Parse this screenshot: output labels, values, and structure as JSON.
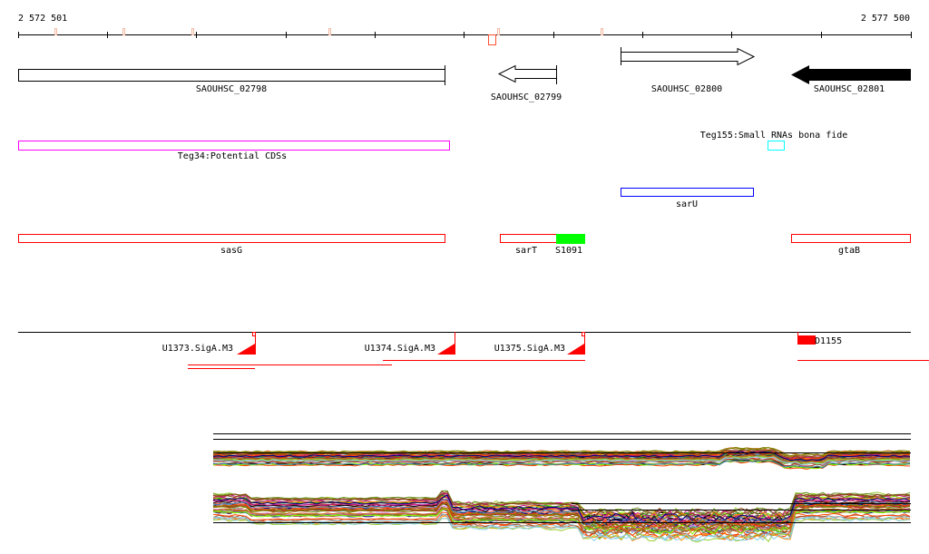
{
  "ruler": {
    "start_label": "2 572 501",
    "end_label": "2 577 500"
  },
  "genes": [
    {
      "name": "SAOUHSC_02798",
      "strand": "none",
      "fill": "#ffffff"
    },
    {
      "name": "SAOUHSC_02799",
      "strand": "-",
      "fill": "#ffffff"
    },
    {
      "name": "SAOUHSC_02800",
      "strand": "+",
      "fill": "#ffffff"
    },
    {
      "name": "SAOUHSC_02801",
      "strand": "-",
      "fill": "#000000"
    }
  ],
  "teg": [
    {
      "name": "Teg34:Potential CDSs",
      "color": "#ff00ff"
    },
    {
      "name": "Teg155:Small RNAs bona fide",
      "color": "#00ffff"
    }
  ],
  "blue_feature": {
    "name": "sarU",
    "color": "#0000ff"
  },
  "red_features": [
    {
      "name": "sasG",
      "color": "#ff0000"
    },
    {
      "name": "sarT",
      "color": "#ff0000"
    },
    {
      "name": "S1091",
      "color": "#00ff00"
    },
    {
      "name": "gtaB",
      "color": "#ff0000"
    }
  ],
  "promoters": [
    {
      "name": "U1373.SigA.M3"
    },
    {
      "name": "U1374.SigA.M3"
    },
    {
      "name": "U1375.SigA.M3"
    },
    {
      "name": "D1155"
    }
  ],
  "colors": {
    "accent_red": "#ff0000",
    "tick_marks": "#f4b8a0"
  }
}
